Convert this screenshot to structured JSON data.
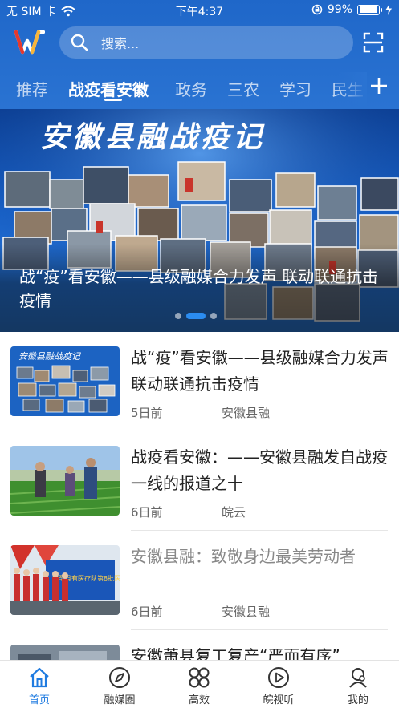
{
  "status_bar": {
    "carrier": "无 SIM 卡",
    "time": "下午4:37",
    "battery": "99%",
    "battery_level": 0.99
  },
  "header": {
    "search_placeholder": "搜索...",
    "icons": [
      "app-logo",
      "search-icon",
      "scan-icon",
      "plus-icon"
    ]
  },
  "tabs": [
    {
      "label": "推荐",
      "active": false
    },
    {
      "label": "战疫看安徽",
      "active": true
    },
    {
      "label": "政务",
      "active": false
    },
    {
      "label": "三农",
      "active": false
    },
    {
      "label": "学习",
      "active": false
    },
    {
      "label": "民生",
      "active": false
    }
  ],
  "banner": {
    "title": "安徽县融战疫记",
    "caption": "战“疫”看安徽——县级融媒合力发声 联动联通抗击疫情",
    "page_count": 3,
    "active_page": 2
  },
  "news": [
    {
      "title": "战“疫”看安徽——县级融媒合力发声 联动联通抗击疫情",
      "time": "5日前",
      "source": "安徽县融",
      "read": false,
      "thumb_caption": "安徽县融战疫记"
    },
    {
      "title": "战疫看安徽：——安徽县融发自战疫一线的报道之十",
      "time": "6日前",
      "source": "皖云",
      "read": false
    },
    {
      "title": "安徽县融：致敬身边最美劳动者",
      "time": "6日前",
      "source": "安徽县融",
      "read": true,
      "thumb_caption": "东至县有医疗队第8批医疗人员"
    },
    {
      "title": "安徽萧县复工复产“严而有序”",
      "time": "",
      "source": "",
      "read": false
    }
  ],
  "bottom_nav": [
    {
      "label": "首页",
      "icon": "home-icon",
      "active": true
    },
    {
      "label": "融媒圈",
      "icon": "compass-icon",
      "active": false
    },
    {
      "label": "高效",
      "icon": "grid-icon",
      "active": false
    },
    {
      "label": "皖视听",
      "icon": "play-icon",
      "active": false
    },
    {
      "label": "我的",
      "icon": "user-icon",
      "active": false
    }
  ],
  "colors": {
    "header": "#1f67c9",
    "accent": "#1f7be0",
    "text": "#222222",
    "muted": "#888888"
  }
}
